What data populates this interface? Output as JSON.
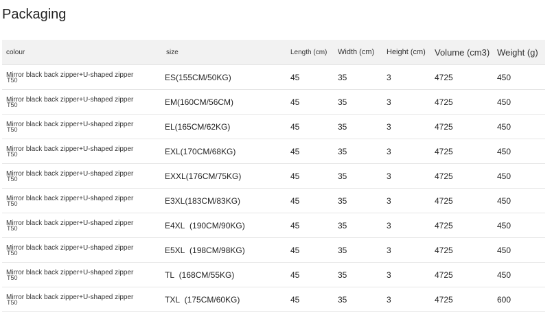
{
  "title": "Packaging",
  "headers": {
    "colour": "colour",
    "size": "size",
    "length": "Length (cm)",
    "width": "Width (cm)",
    "height": "Height (cm)",
    "volume": "Volume (cm3)",
    "weight": "Weight (g)"
  },
  "rows": [
    {
      "colour": "Mirror black back zipper+U-shaped zipper",
      "colour_sub": "T50",
      "size": "ES(155CM/50KG)",
      "length": "45",
      "width": "35",
      "height": "3",
      "volume": "4725",
      "weight": "450"
    },
    {
      "colour": "Mirror black back zipper+U-shaped zipper",
      "colour_sub": "T50",
      "size": "EM(160CM/56CM)",
      "length": "45",
      "width": "35",
      "height": "3",
      "volume": "4725",
      "weight": "450"
    },
    {
      "colour": "Mirror black back zipper+U-shaped zipper",
      "colour_sub": "T50",
      "size": "EL(165CM/62KG)",
      "length": "45",
      "width": "35",
      "height": "3",
      "volume": "4725",
      "weight": "450"
    },
    {
      "colour": "Mirror black back zipper+U-shaped zipper",
      "colour_sub": "T50",
      "size": "EXL(170CM/68KG)",
      "length": "45",
      "width": "35",
      "height": "3",
      "volume": "4725",
      "weight": "450"
    },
    {
      "colour": "Mirror black back zipper+U-shaped zipper",
      "colour_sub": "T50",
      "size": "EXXL(176CM/75KG)",
      "length": "45",
      "width": "35",
      "height": "3",
      "volume": "4725",
      "weight": "450"
    },
    {
      "colour": "Mirror black back zipper+U-shaped zipper",
      "colour_sub": "T50",
      "size": "E3XL(183CM/83KG)",
      "length": "45",
      "width": "35",
      "height": "3",
      "volume": "4725",
      "weight": "450"
    },
    {
      "colour": "Mirror black back zipper+U-shaped zipper",
      "colour_sub": "T50",
      "size": "E4XL  (190CM/90KG)",
      "length": "45",
      "width": "35",
      "height": "3",
      "volume": "4725",
      "weight": "450"
    },
    {
      "colour": "Mirror black back zipper+U-shaped zipper",
      "colour_sub": "T50",
      "size": "E5XL  (198CM/98KG)",
      "length": "45",
      "width": "35",
      "height": "3",
      "volume": "4725",
      "weight": "450"
    },
    {
      "colour": "Mirror black back zipper+U-shaped zipper",
      "colour_sub": "T50",
      "size": "TL  (168CM/55KG)",
      "length": "45",
      "width": "35",
      "height": "3",
      "volume": "4725",
      "weight": "450"
    },
    {
      "colour": "Mirror black back zipper+U-shaped zipper",
      "colour_sub": "T50",
      "size": "TXL  (175CM/60KG)",
      "length": "45",
      "width": "35",
      "height": "3",
      "volume": "4725",
      "weight": "600"
    }
  ]
}
